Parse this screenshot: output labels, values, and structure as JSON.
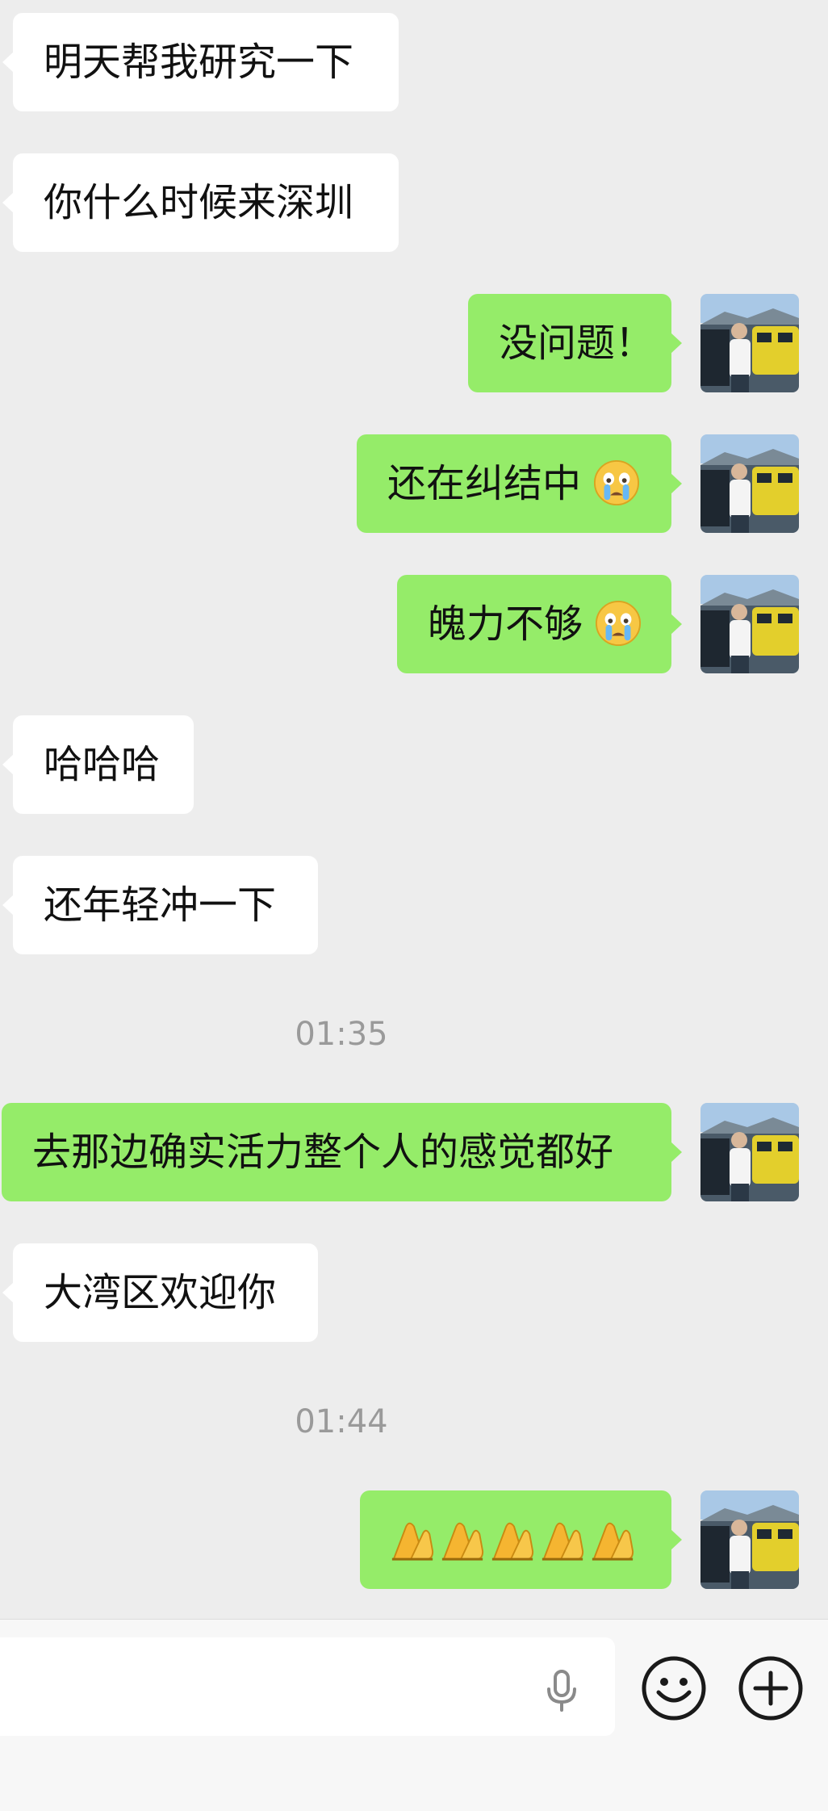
{
  "messages": [
    {
      "side": "in",
      "text": "明天帮我研究一下"
    },
    {
      "side": "in",
      "text": "你什么时候来深圳"
    },
    {
      "side": "out",
      "text": "没问题！"
    },
    {
      "side": "out",
      "text": "还在纠结中",
      "emoji": "crying-face-emoji"
    },
    {
      "side": "out",
      "text": "魄力不够",
      "emoji": "crying-face-emoji"
    },
    {
      "side": "in",
      "text": "哈哈哈"
    },
    {
      "side": "in",
      "text": "还年轻冲一下"
    },
    {
      "type": "time",
      "text": "01:35"
    },
    {
      "side": "out",
      "text": "去那边确实活力整个人的感觉都好"
    },
    {
      "side": "in",
      "text": "大湾区欢迎你"
    },
    {
      "type": "time",
      "text": "01:44"
    },
    {
      "side": "out",
      "text": "",
      "emoji": "folded-hands-emoji",
      "emoji_count": 5
    }
  ],
  "input_bar": {
    "placeholder": "",
    "icons": [
      "microphone-icon",
      "emoji-face-icon",
      "plus-circle-icon"
    ]
  },
  "colors": {
    "background": "#ededed",
    "incoming_bubble": "#ffffff",
    "outgoing_bubble": "#95ec69",
    "timestamp_text": "#9a9a9a"
  }
}
